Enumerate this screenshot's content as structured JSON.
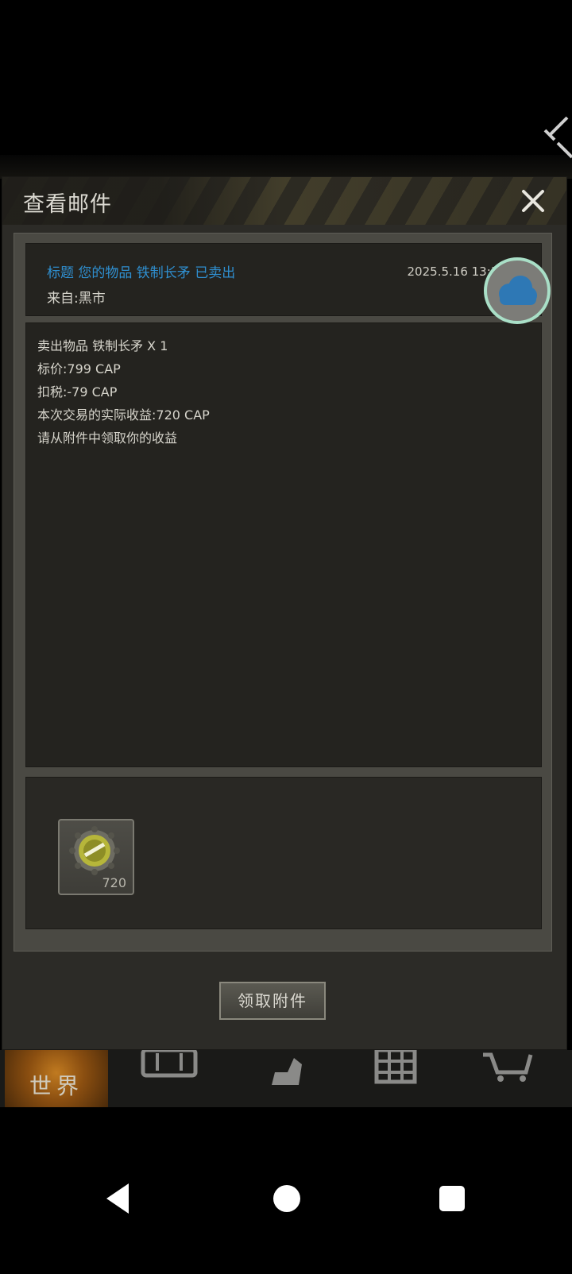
{
  "dialog": {
    "title": "查看邮件"
  },
  "mail": {
    "subject": "标题 您的物品 铁制长矛 已卖出",
    "from": "来自:黑市",
    "date": "2025.5.16 13:11:39",
    "body_lines": [
      "卖出物品 铁制长矛 X 1",
      "标价:799 CAP",
      "扣税:-79 CAP",
      "本次交易的实际收益:720 CAP",
      "请从附件中领取你的收益"
    ]
  },
  "attachment": {
    "icon": "bottle-cap-icon",
    "count": "720"
  },
  "claim_button": {
    "label": "领取附件"
  },
  "bottom_nav": {
    "world_label": "世界",
    "items": [
      "world-icon",
      "backpack-icon",
      "character-icon",
      "building-icon",
      "cart-icon"
    ]
  },
  "colors": {
    "subject": "#2f8fd0",
    "cloud": "#2e78b5",
    "fab_ring": "#a9dfc7"
  }
}
